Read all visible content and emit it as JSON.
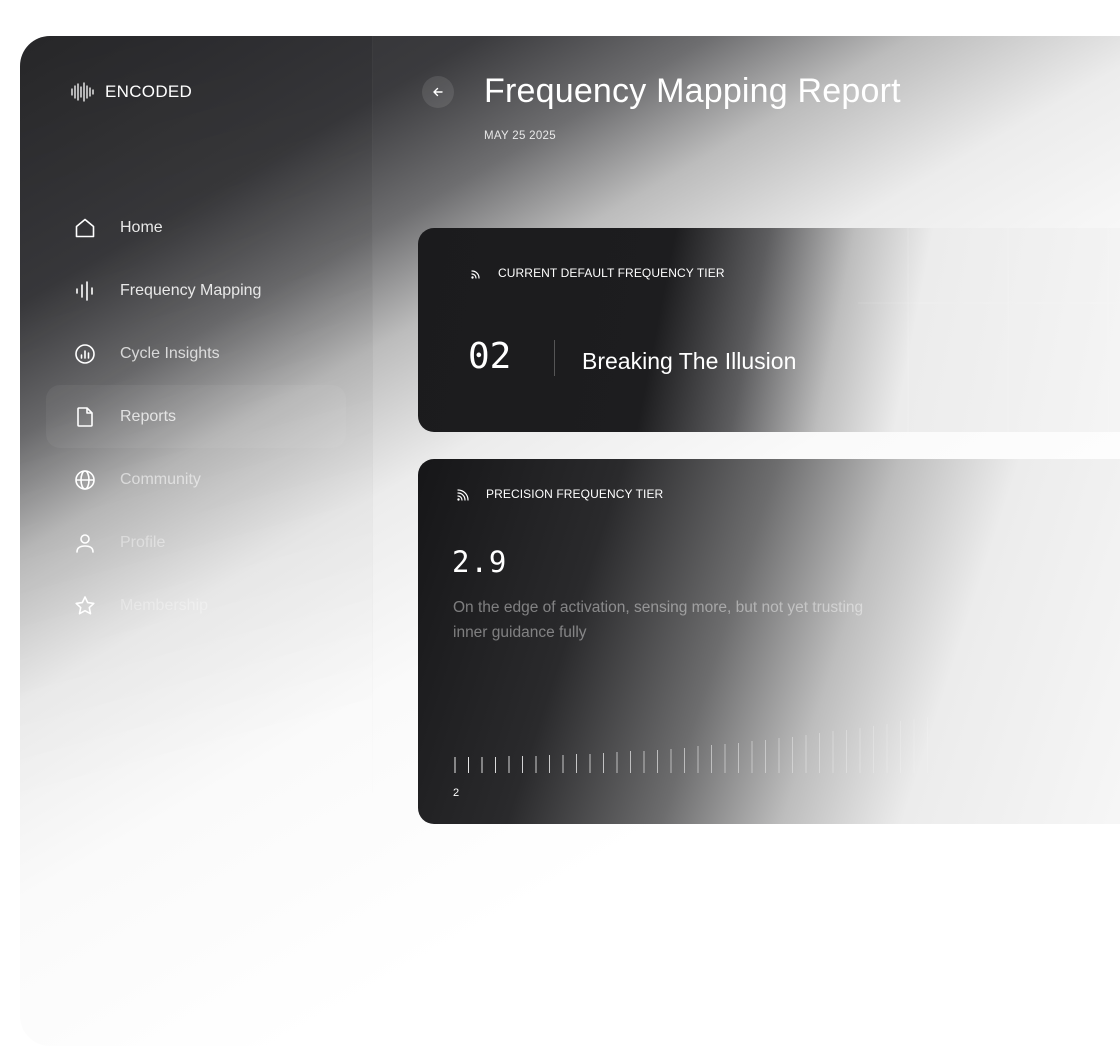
{
  "app": {
    "name": "ENCODED"
  },
  "sidebar": {
    "items": [
      {
        "label": "Home",
        "icon": "home-icon"
      },
      {
        "label": "Frequency Mapping",
        "icon": "waveform-icon"
      },
      {
        "label": "Cycle Insights",
        "icon": "chart-circle-icon"
      },
      {
        "label": "Reports",
        "icon": "document-icon",
        "active": true
      },
      {
        "label": "Community",
        "icon": "globe-icon"
      },
      {
        "label": "Profile",
        "icon": "user-icon"
      },
      {
        "label": "Membership",
        "icon": "star-icon"
      }
    ]
  },
  "header": {
    "title": "Frequency Mapping Report",
    "date": "MAY 25 2025"
  },
  "current_tier": {
    "label": "CURRENT DEFAULT FREQUENCY TIER",
    "number": "02",
    "name": "Breaking The Illusion"
  },
  "precision_tier": {
    "label": "PRECISION FREQUENCY TIER",
    "value": "2.9",
    "description": "On the edge of activation, sensing more, but not yet trusting inner guidance fully",
    "scale_start_label": "2"
  },
  "colors": {
    "card_dark": "#1b1b1d",
    "text_primary": "#ffffff"
  }
}
